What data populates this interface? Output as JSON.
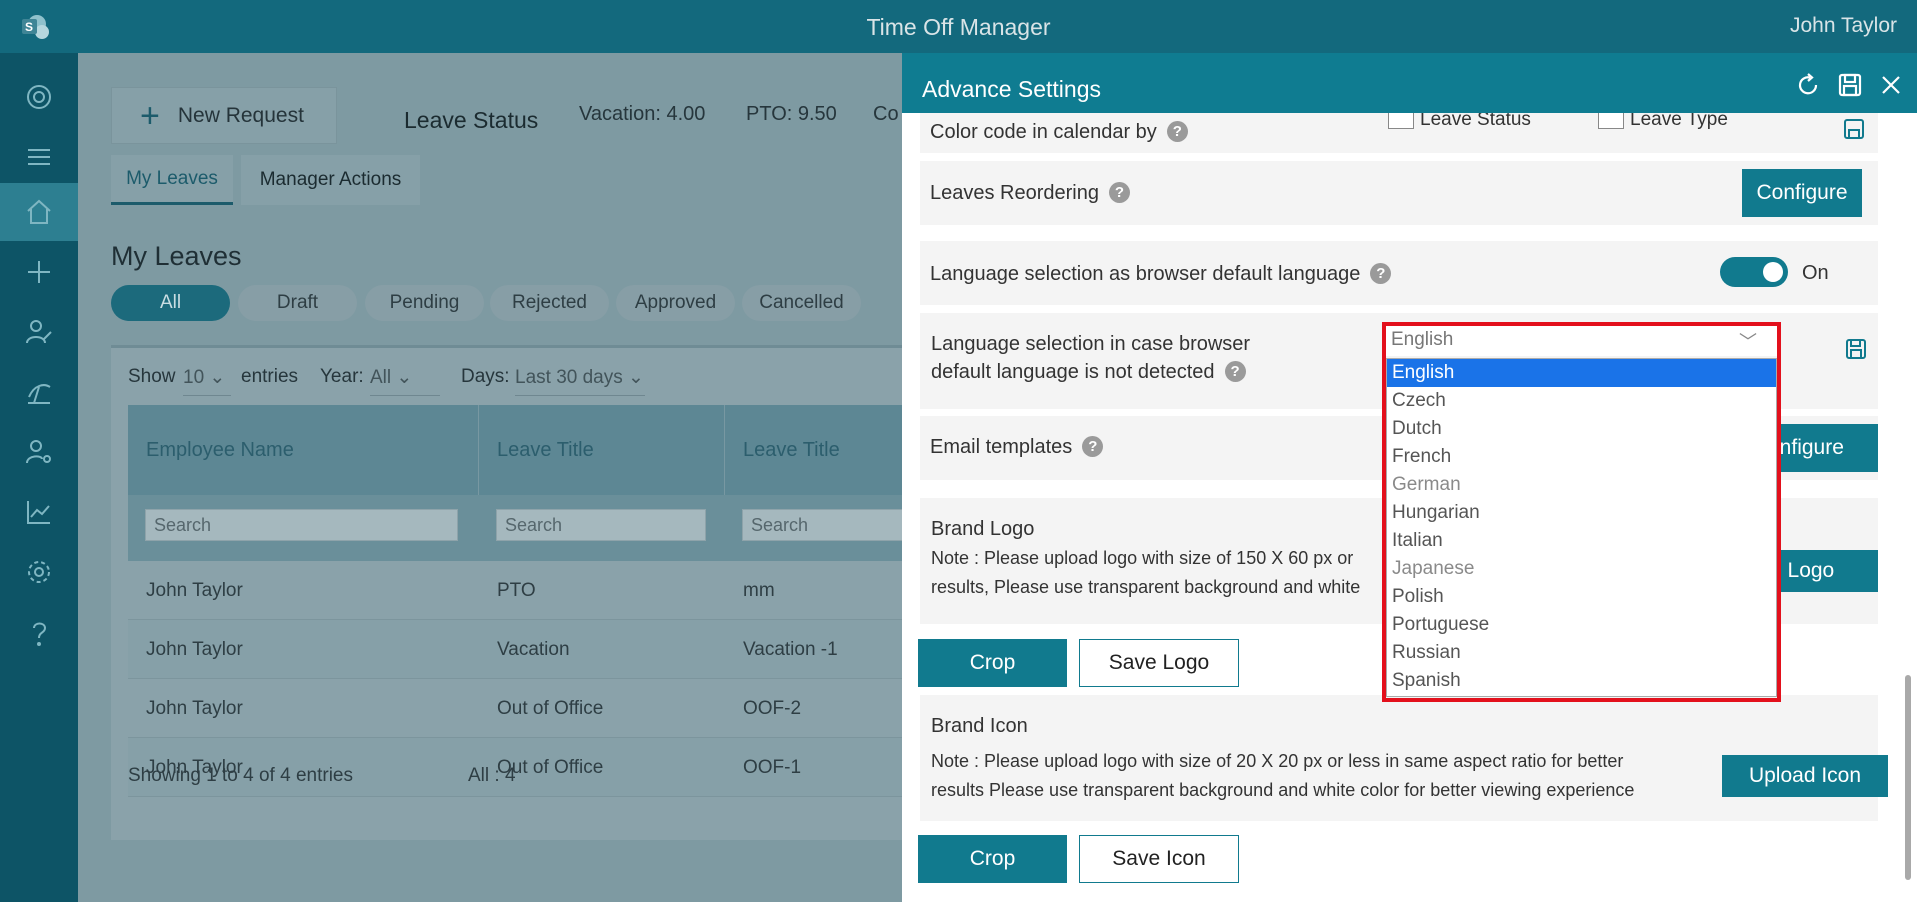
{
  "topbar": {
    "app_title": "Time Off Manager",
    "user_name": "John Taylor"
  },
  "rail": {
    "items": [
      "logo-icon",
      "menu-icon",
      "home-icon",
      "add-icon",
      "user-edit-icon",
      "vacation-icon",
      "user-settings-icon",
      "chart-icon",
      "gear-icon",
      "help-icon"
    ]
  },
  "main": {
    "new_request": "New Request",
    "plus": "+",
    "leave_status_label": "Leave Status",
    "stats": {
      "vacation": "Vacation: 4.00",
      "pto": "PTO: 9.50",
      "cut": "Co"
    },
    "tabs": [
      "My Leaves",
      "Manager Actions"
    ],
    "heading": "My Leaves",
    "filters": [
      "All",
      "Draft",
      "Pending",
      "Rejected",
      "Approved",
      "Cancelled"
    ],
    "controls": {
      "show": "Show",
      "show_value": "10",
      "entries": "entries",
      "year": "Year:",
      "year_value": "All",
      "days": "Days:",
      "days_value": "Last 30 days"
    },
    "columns": [
      "Employee Name",
      "Leave Title",
      "Leave Title"
    ],
    "search_placeholder": "Search",
    "rows": [
      [
        "John Taylor",
        "PTO",
        "mm"
      ],
      [
        "John Taylor",
        "Vacation",
        "Vacation -1"
      ],
      [
        "John Taylor",
        "Out of Office",
        "OOF-2"
      ],
      [
        "John Taylor",
        "Out of Office",
        "OOF-1"
      ]
    ],
    "footer_showing": "Showing 1 to 4 of 4 entries",
    "footer_all": "All : 4"
  },
  "panel": {
    "title": "Advance Settings",
    "color_code_label": "Color code in calendar by",
    "color_code_opt1": "Leave Status",
    "color_code_opt2": "Leave Type",
    "reorder_label": "Leaves Reordering",
    "configure": "Configure",
    "browser_lang_label": "Language selection as browser default language",
    "toggle_state": "On",
    "fallback_lang_label_1": "Language selection in case browser",
    "fallback_lang_label_2": "default language is not detected",
    "email_label": "Email templates",
    "email_configure_partial": "onfigure",
    "brand_logo_title": "Brand Logo",
    "brand_logo_note_1": "Note : Please upload logo with size of 150 X 60 px or",
    "brand_logo_note_2": "results, Please use transparent background and white",
    "upload_logo_partial": "d Logo",
    "crop": "Crop",
    "save_logo": "Save Logo",
    "brand_icon_title": "Brand Icon",
    "brand_icon_note_1": "Note : Please upload logo with size of 20 X 20 px or less in same aspect ratio for better",
    "brand_icon_note_2": "results Please use transparent background and white color for better viewing experience",
    "upload_icon": "Upload Icon",
    "save_icon": "Save Icon",
    "help": "?"
  },
  "language_dropdown": {
    "selected": "English",
    "chevron": "﹀",
    "options": [
      "English",
      "Czech",
      "Dutch",
      "French",
      "German",
      "Hungarian",
      "Italian",
      "Japanese",
      "Polish",
      "Portuguese",
      "Russian",
      "Spanish"
    ],
    "highlighted": "English"
  },
  "colors": {
    "header": "#13697d",
    "panel_header": "#0f7c91",
    "accent": "#117a8e",
    "highlight": "#1a73e8",
    "outline": "#e3101c"
  }
}
